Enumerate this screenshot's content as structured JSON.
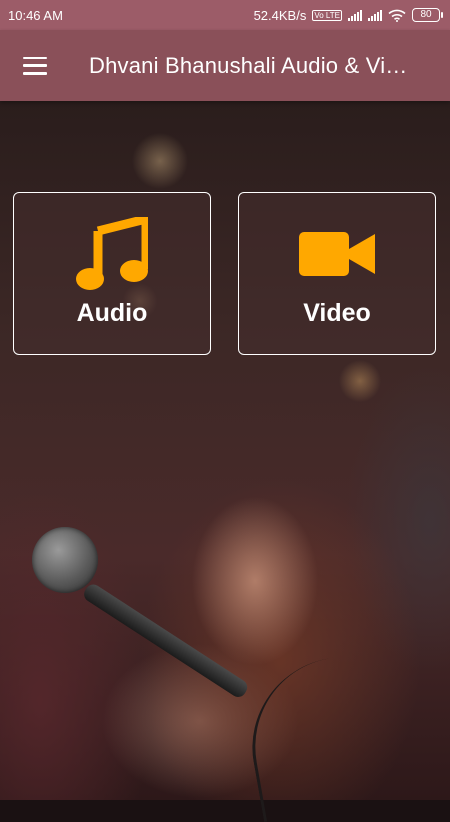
{
  "status_bar": {
    "time": "10:46 AM",
    "network_speed": "52.4KB/s",
    "volte_badge": "Vo LTE",
    "battery_level": "80",
    "icons": [
      "volte-icon",
      "signal-icon",
      "signal-icon",
      "wifi-icon",
      "battery-icon"
    ]
  },
  "app_bar": {
    "menu_icon": "hamburger-menu-icon",
    "title": "Dhvani Bhanushali Audio & Vi…"
  },
  "cards": {
    "audio": {
      "label": "Audio",
      "icon": "music-note-icon",
      "icon_color": "#FFA800"
    },
    "video": {
      "label": "Video",
      "icon": "video-camera-icon",
      "icon_color": "#FFA800"
    }
  },
  "theme": {
    "status_bar_color": "#9C5C68",
    "app_bar_color": "#8A5059",
    "card_border_color": "#FFFFFF",
    "accent": "#FFA800"
  }
}
